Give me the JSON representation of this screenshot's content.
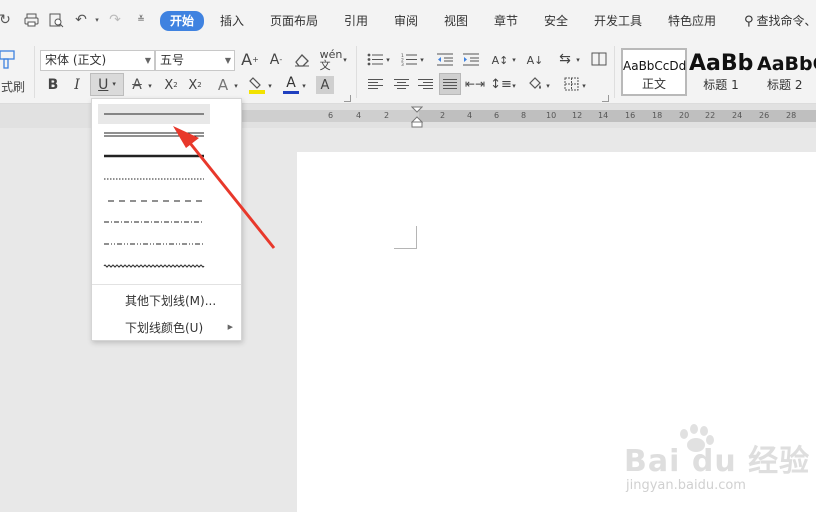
{
  "menu_tabs": [
    {
      "label": "开始",
      "active": true
    },
    {
      "label": "插入"
    },
    {
      "label": "页面布局"
    },
    {
      "label": "引用"
    },
    {
      "label": "审阅"
    },
    {
      "label": "视图"
    },
    {
      "label": "章节"
    },
    {
      "label": "安全"
    },
    {
      "label": "开发工具"
    },
    {
      "label": "特色应用"
    }
  ],
  "search": {
    "label": "查找命令、"
  },
  "quick_access_icons": [
    "redo-icon",
    "print-icon",
    "print-preview-icon",
    "undo-icon",
    "redo-arrow-icon",
    "customize-icon"
  ],
  "ribbon": {
    "format_painter_label": "式刷",
    "font_name": "宋体 (正文)",
    "font_size": "五号",
    "buttons": {
      "bold": "B",
      "italic": "I",
      "underline": "U",
      "text_effect": "A",
      "font_color": "A",
      "char_shading": "A"
    },
    "styles": [
      {
        "sample": "AaBbCcDd",
        "name": "正文",
        "selected": true
      },
      {
        "sample": "AaBb",
        "name": "标题 1"
      },
      {
        "sample": "AaBbC",
        "name": "标题 2"
      }
    ]
  },
  "ruler": {
    "labels": [
      "6",
      "4",
      "2",
      "2",
      "4",
      "6",
      "8",
      "10",
      "12",
      "14",
      "16",
      "18",
      "20",
      "22",
      "24",
      "26",
      "28"
    ]
  },
  "underline_menu": {
    "styles": [
      "single",
      "double",
      "thick",
      "dotted",
      "dashed",
      "dash-dot",
      "dash-dot-dot",
      "wave"
    ],
    "more_label": "其他下划线(M)...",
    "color_label": "下划线颜色(U)"
  },
  "watermark": {
    "brand": "Bai du 经验",
    "url": "jingyan.baidu.com"
  },
  "colors": {
    "accent": "#3f82e0",
    "arrow": "#e8382b",
    "highlight": "#f2e200",
    "font_color": "#1f3fbf"
  }
}
